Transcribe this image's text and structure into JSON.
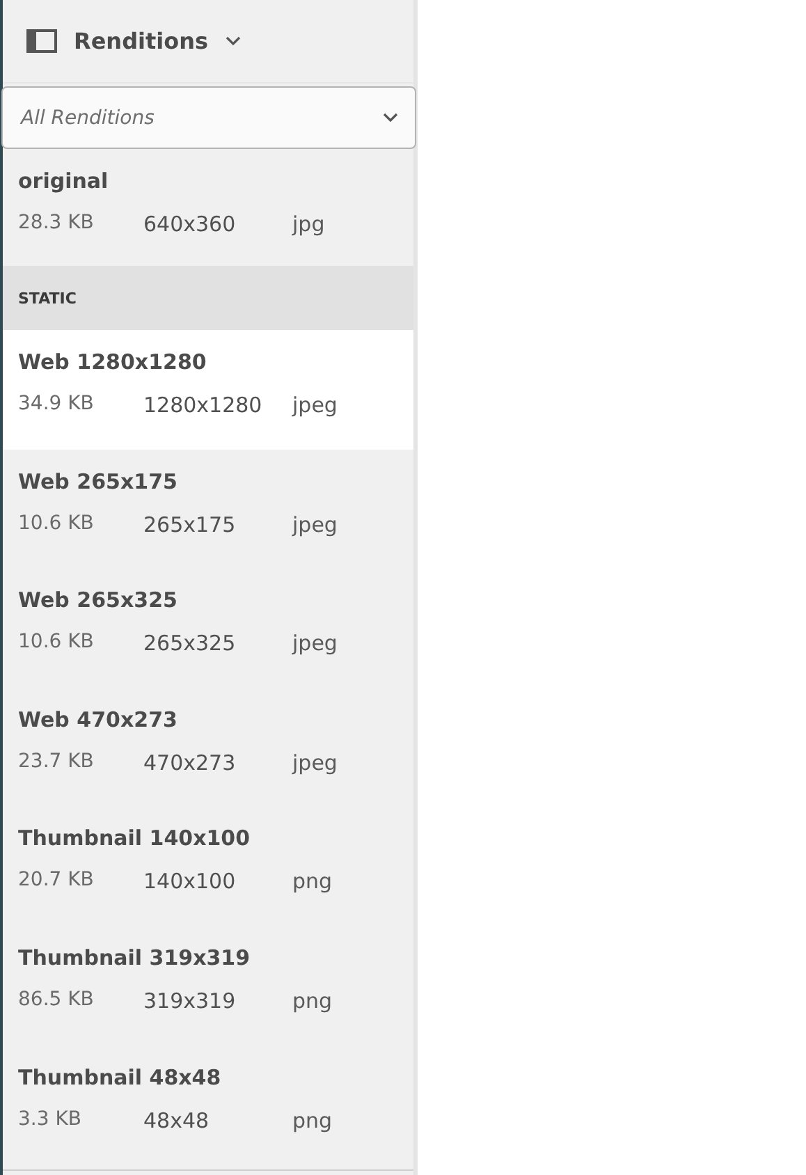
{
  "panel_header": {
    "title": "Renditions"
  },
  "filter": {
    "value": "All Renditions"
  },
  "original": {
    "name": "original",
    "size": "28.3 KB",
    "dimensions": "640x360",
    "format": "jpg",
    "selected": false
  },
  "section": {
    "title": "STATIC"
  },
  "renditions": [
    {
      "name": "Web 1280x1280",
      "size": "34.9 KB",
      "dimensions": "1280x1280",
      "format": "jpeg",
      "selected": true
    },
    {
      "name": "Web 265x175",
      "size": "10.6 KB",
      "dimensions": "265x175",
      "format": "jpeg",
      "selected": false
    },
    {
      "name": "Web 265x325",
      "size": "10.6 KB",
      "dimensions": "265x325",
      "format": "jpeg",
      "selected": false
    },
    {
      "name": "Web 470x273",
      "size": "23.7 KB",
      "dimensions": "470x273",
      "format": "jpeg",
      "selected": false
    },
    {
      "name": "Thumbnail 140x100",
      "size": "20.7 KB",
      "dimensions": "140x100",
      "format": "png",
      "selected": false
    },
    {
      "name": "Thumbnail 319x319",
      "size": "86.5 KB",
      "dimensions": "319x319",
      "format": "png",
      "selected": false
    },
    {
      "name": "Thumbnail 48x48",
      "size": "3.3 KB",
      "dimensions": "48x48",
      "format": "png",
      "selected": false
    }
  ]
}
